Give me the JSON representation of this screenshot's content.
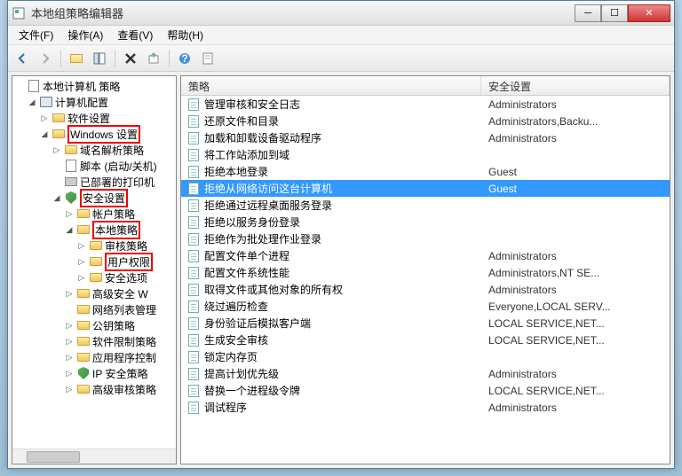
{
  "window": {
    "title": "本地组策略编辑器"
  },
  "menu": {
    "file": "文件(F)",
    "action": "操作(A)",
    "view": "查看(V)",
    "help": "帮助(H)"
  },
  "titlebar_buttons": {
    "minimize": "─",
    "maximize": "☐",
    "close": "✕"
  },
  "tree": {
    "root": "本地计算机 策略",
    "computer_config": "计算机配置",
    "software_settings": "软件设置",
    "windows_settings": "Windows 设置",
    "dns_policy": "域名解析策略",
    "scripts": "脚本 (启动/关机)",
    "deployed_printers": "已部署的打印机",
    "security_settings": "安全设置",
    "account_policies": "帐户策略",
    "local_policies": "本地策略",
    "audit_policy": "审核策略",
    "user_rights": "用户权限",
    "security_options": "安全选项",
    "advanced_w": "高级安全 W",
    "network_list": "网络列表管理",
    "public_key": "公钥策略",
    "software_restriction": "软件限制策略",
    "app_control": "应用程序控制",
    "ip_security": "IP 安全策略",
    "advanced_audit": "高级审核策略"
  },
  "columns": {
    "policy": "策略",
    "setting": "安全设置"
  },
  "policies": [
    {
      "name": "管理审核和安全日志",
      "setting": "Administrators"
    },
    {
      "name": "还原文件和目录",
      "setting": "Administrators,Backu..."
    },
    {
      "name": "加载和卸载设备驱动程序",
      "setting": "Administrators"
    },
    {
      "name": "将工作站添加到域",
      "setting": ""
    },
    {
      "name": "拒绝本地登录",
      "setting": "Guest"
    },
    {
      "name": "拒绝从网络访问这台计算机",
      "setting": "Guest",
      "selected": true
    },
    {
      "name": "拒绝通过远程桌面服务登录",
      "setting": ""
    },
    {
      "name": "拒绝以服务身份登录",
      "setting": ""
    },
    {
      "name": "拒绝作为批处理作业登录",
      "setting": ""
    },
    {
      "name": "配置文件单个进程",
      "setting": "Administrators"
    },
    {
      "name": "配置文件系统性能",
      "setting": "Administrators,NT SE..."
    },
    {
      "name": "取得文件或其他对象的所有权",
      "setting": "Administrators"
    },
    {
      "name": "绕过遍历检查",
      "setting": "Everyone,LOCAL SERV..."
    },
    {
      "name": "身份验证后模拟客户端",
      "setting": "LOCAL SERVICE,NET..."
    },
    {
      "name": "生成安全审核",
      "setting": "LOCAL SERVICE,NET..."
    },
    {
      "name": "锁定内存页",
      "setting": ""
    },
    {
      "name": "提高计划优先级",
      "setting": "Administrators"
    },
    {
      "name": "替换一个进程级令牌",
      "setting": "LOCAL SERVICE,NET..."
    },
    {
      "name": "调试程序",
      "setting": "Administrators"
    }
  ]
}
